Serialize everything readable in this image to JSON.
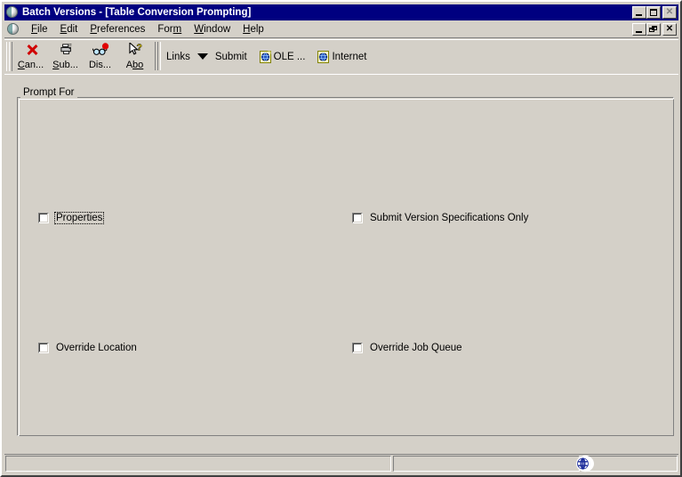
{
  "window": {
    "title": "Batch Versions - [Table Conversion Prompting]",
    "title_icon": "sphere-icon",
    "buttons": {
      "minimize": "minimize-button",
      "maximize": "maximize-button",
      "close": "close-button",
      "close_glyph": "✕",
      "mdi_minimize": "mdi-minimize-button",
      "mdi_restore": "mdi-restore-button",
      "mdi_close": "mdi-close-button"
    }
  },
  "menu": {
    "icon": "sphere-icon",
    "items": [
      {
        "label": "File",
        "accel": "F"
      },
      {
        "label": "Edit",
        "accel": "E"
      },
      {
        "label": "Preferences",
        "accel": "P"
      },
      {
        "label": "Form",
        "accel": "m"
      },
      {
        "label": "Window",
        "accel": "W"
      },
      {
        "label": "Help",
        "accel": "H"
      }
    ]
  },
  "toolbar": {
    "buttons": [
      {
        "label": "Can...",
        "accel": "C",
        "icon": "red-x-icon",
        "tooltip": "Cancel"
      },
      {
        "label": "Sub...",
        "accel": "S",
        "icon": "printer-icon",
        "tooltip": "Submit"
      },
      {
        "label": "Dis...",
        "accel": "",
        "icon": "glasses-balloon-icon",
        "tooltip": "Display"
      },
      {
        "label": "Abo",
        "accel": "bo",
        "icon": "arrow-question-icon",
        "tooltip": "About"
      }
    ],
    "links_label": "Links",
    "dropdown_icon": "chevron-down-icon",
    "links": [
      {
        "label": "Submit",
        "icon": ""
      },
      {
        "label": "OLE ...",
        "icon": "ole-document-icon"
      },
      {
        "label": "Internet",
        "icon": "internet-globe-icon"
      }
    ]
  },
  "form": {
    "groupbox_title": "Prompt For",
    "checkboxes": [
      {
        "label": "Properties",
        "checked": false,
        "focused": true
      },
      {
        "label": "Submit Version Specifications Only",
        "checked": false,
        "focused": false
      },
      {
        "label": "Override Location",
        "checked": false,
        "focused": false
      },
      {
        "label": "Override Job Queue",
        "checked": false,
        "focused": false
      }
    ]
  },
  "status_bar": {
    "pane1": "",
    "pane2": "",
    "pane3": "",
    "globe_icon": "internet-globe-icon"
  },
  "colors": {
    "face": "#d4d0c8",
    "title_active": "#000080",
    "title_text": "#ffffff",
    "accent_red": "#d00000",
    "shadow": "#808080",
    "highlight": "#ffffff"
  }
}
